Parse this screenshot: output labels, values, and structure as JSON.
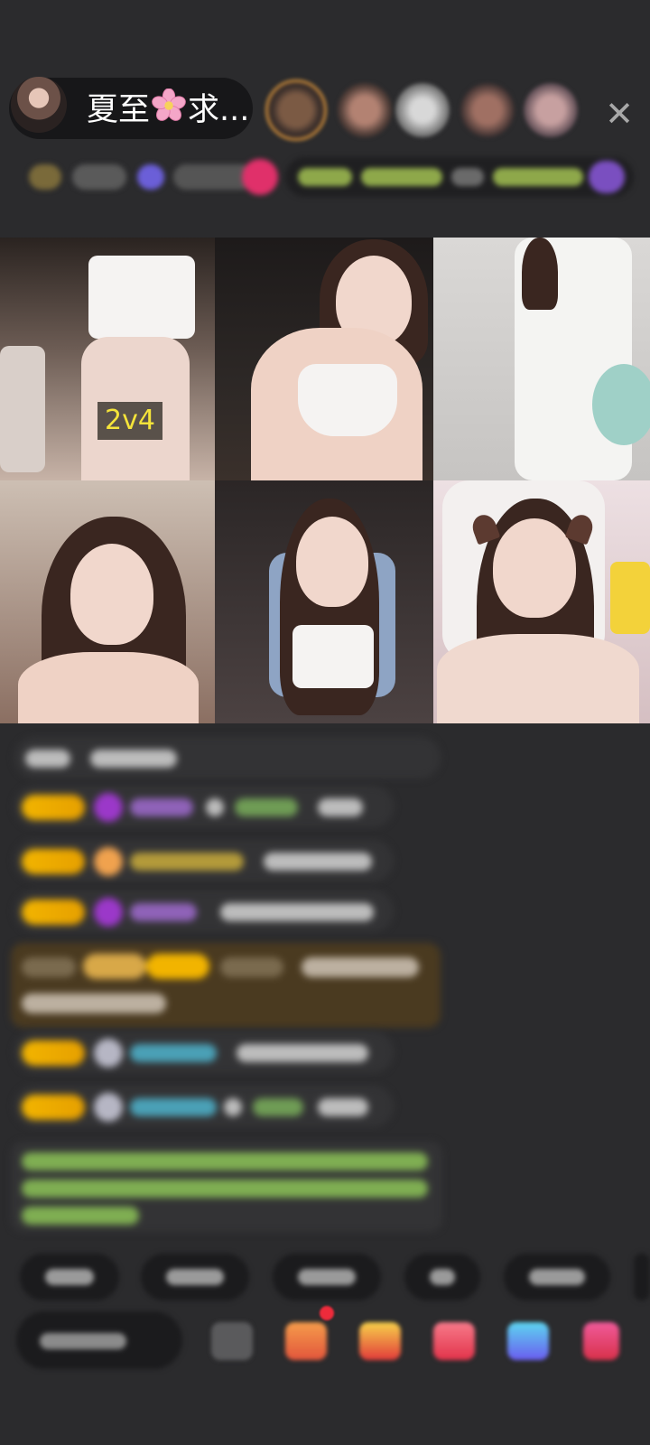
{
  "header": {
    "host_name_prefix": "夏至",
    "host_name_suffix": "求...",
    "host_name_emoji": "cherry-blossom-icon",
    "close_label": "✕"
  },
  "stream_grid": {
    "tiles": [
      {
        "id": "seat-1",
        "score_badge": "2v4"
      },
      {
        "id": "seat-2"
      },
      {
        "id": "seat-3"
      },
      {
        "id": "seat-4"
      },
      {
        "id": "seat-5"
      },
      {
        "id": "seat-6"
      }
    ]
  },
  "colors": {
    "background": "#2b2b2d",
    "pill_dark": "#171719",
    "badge_gold": "#f2b400",
    "score_text": "#f5e43a",
    "notice_bg": "#4a3a20"
  }
}
